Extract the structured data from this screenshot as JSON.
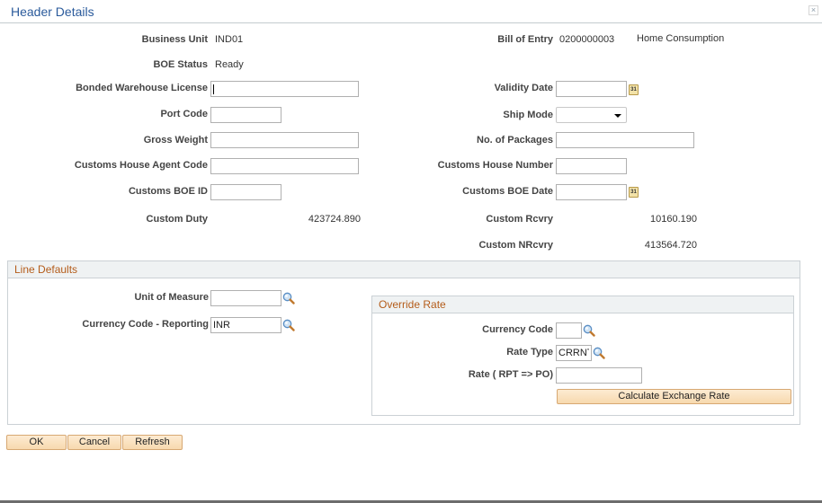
{
  "window": {
    "title": "Header Details",
    "close_label": "×"
  },
  "header": {
    "business_unit": {
      "label": "Business Unit",
      "value": "IND01"
    },
    "bill_of_entry": {
      "label": "Bill of Entry",
      "value": "0200000003",
      "type": "Home Consumption"
    },
    "boe_status": {
      "label": "BOE Status",
      "value": "Ready"
    },
    "bonded_warehouse_license": {
      "label": "Bonded Warehouse License",
      "value": ""
    },
    "validity_date": {
      "label": "Validity Date",
      "value": ""
    },
    "port_code": {
      "label": "Port Code",
      "value": ""
    },
    "ship_mode": {
      "label": "Ship Mode",
      "value": ""
    },
    "gross_weight": {
      "label": "Gross Weight",
      "value": ""
    },
    "no_of_packages": {
      "label": "No. of Packages",
      "value": ""
    },
    "customs_house_agent_code": {
      "label": "Customs House Agent Code",
      "value": ""
    },
    "customs_house_number": {
      "label": "Customs House Number",
      "value": ""
    },
    "customs_boe_id": {
      "label": "Customs BOE ID",
      "value": ""
    },
    "customs_boe_date": {
      "label": "Customs BOE Date",
      "value": ""
    },
    "custom_duty": {
      "label": "Custom Duty",
      "value": "423724.890"
    },
    "custom_rcvry": {
      "label": "Custom Rcvry",
      "value": "10160.190"
    },
    "custom_nrcvry": {
      "label": "Custom NRcvry",
      "value": "413564.720"
    }
  },
  "calendar_icon_text": "31",
  "line_defaults": {
    "title": "Line Defaults",
    "unit_of_measure": {
      "label": "Unit of Measure",
      "value": ""
    },
    "currency_code_reporting": {
      "label": "Currency Code - Reporting",
      "value": "INR"
    }
  },
  "override_rate": {
    "title": "Override Rate",
    "currency_code": {
      "label": "Currency Code",
      "value": ""
    },
    "rate_type": {
      "label": "Rate Type",
      "value": "CRRNT"
    },
    "rate": {
      "label": "Rate ( RPT => PO)",
      "value": ""
    },
    "calculate_button": "Calculate Exchange Rate"
  },
  "footer": {
    "ok_label": "OK",
    "cancel_label": "Cancel",
    "refresh_label": "Refresh"
  }
}
